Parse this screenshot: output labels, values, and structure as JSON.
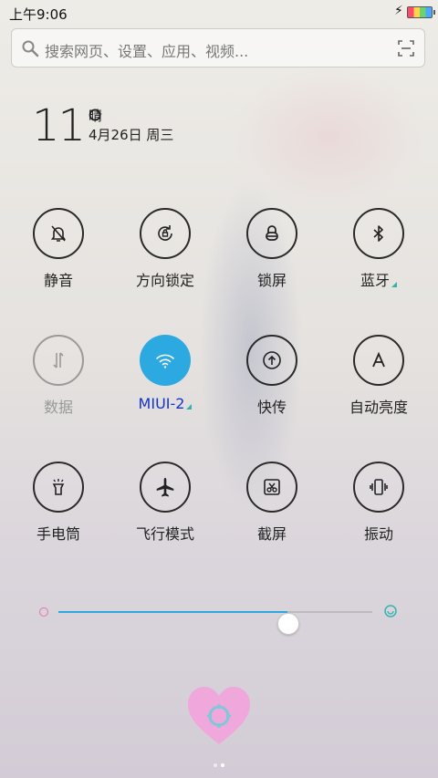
{
  "status": {
    "time": "上午9:06"
  },
  "search": {
    "placeholder": "搜索网页、设置、应用、视频..."
  },
  "weather": {
    "temperature": "11°",
    "condition": "晴",
    "date": "4月26日 周三"
  },
  "toggles": [
    {
      "label": "静音",
      "icon": "bell-off-icon",
      "state": "off"
    },
    {
      "label": "方向锁定",
      "icon": "rotation-lock-icon",
      "state": "off"
    },
    {
      "label": "锁屏",
      "icon": "lock-icon",
      "state": "off"
    },
    {
      "label": "蓝牙",
      "icon": "bluetooth-icon",
      "state": "off"
    },
    {
      "label": "数据",
      "icon": "mobile-data-icon",
      "state": "disabled"
    },
    {
      "label": "MIUI-2",
      "icon": "wifi-icon",
      "state": "on"
    },
    {
      "label": "快传",
      "icon": "share-upload-icon",
      "state": "off"
    },
    {
      "label": "自动亮度",
      "icon": "auto-brightness-icon",
      "state": "off"
    },
    {
      "label": "手电筒",
      "icon": "flashlight-icon",
      "state": "off"
    },
    {
      "label": "飞行模式",
      "icon": "airplane-icon",
      "state": "off"
    },
    {
      "label": "截屏",
      "icon": "screenshot-icon",
      "state": "off"
    },
    {
      "label": "振动",
      "icon": "vibrate-icon",
      "state": "off"
    }
  ],
  "brightness": {
    "level": 0.73
  },
  "colors": {
    "accent": "#2da9e1",
    "active_label": "#1434c8",
    "brightness_low": "#e86fb6"
  },
  "pager": {
    "pages": 2,
    "current": 2
  }
}
